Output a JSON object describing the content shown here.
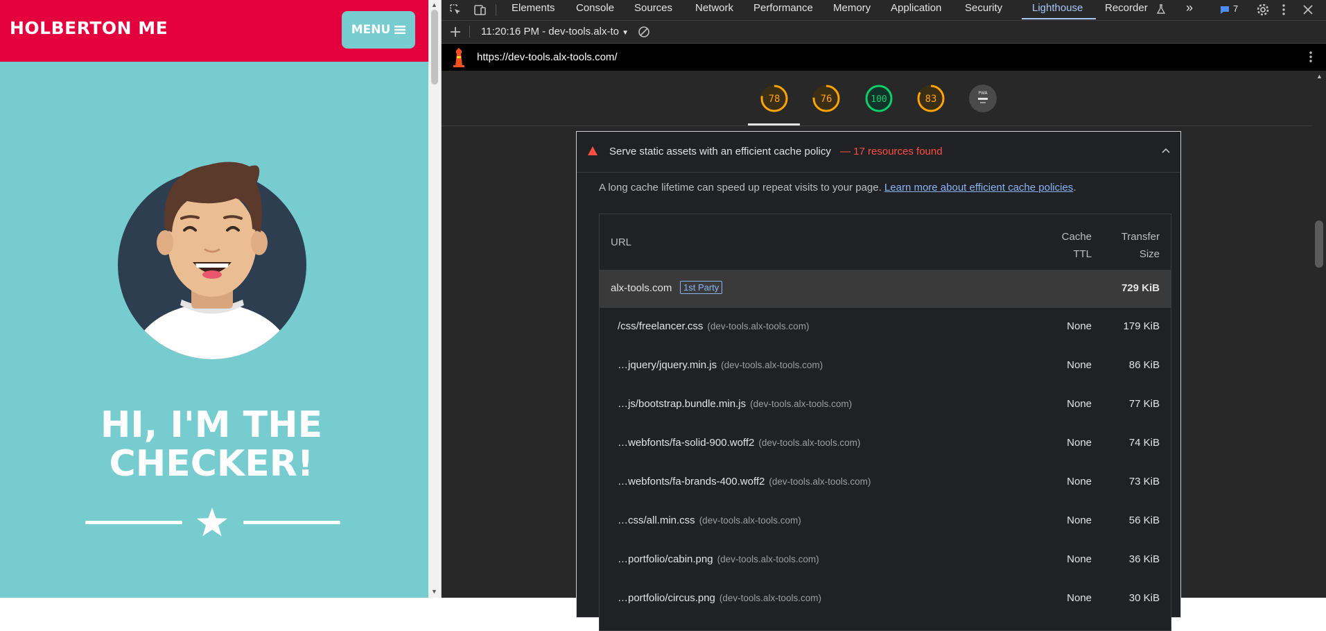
{
  "page": {
    "brand": "HOLBERTON ME",
    "menu_label": "MENU",
    "hero_line1": "HI, I'M THE",
    "hero_line2": "CHECKER!"
  },
  "devtools": {
    "tabs": [
      "Elements",
      "Console",
      "Sources",
      "Network",
      "Performance",
      "Memory",
      "Application",
      "Security",
      "Lighthouse",
      "Recorder"
    ],
    "active_tab": "Lighthouse",
    "issues_count": "7",
    "report_selector": "11:20:16 PM - dev-tools.alx-to",
    "report_url": "https://dev-tools.alx-tools.com/",
    "scores": [
      {
        "value": 78,
        "label": "78",
        "color": "#ffa400"
      },
      {
        "value": 76,
        "label": "76",
        "color": "#ffa400"
      },
      {
        "value": 100,
        "label": "100",
        "color": "#0cce6b"
      },
      {
        "value": 83,
        "label": "83",
        "color": "#ffa400"
      },
      {
        "label": "PWA",
        "color": "#9e9e9e"
      }
    ],
    "audit": {
      "title": "Serve static assets with an efficient cache policy",
      "summary": "— 17 resources found",
      "description": "A long cache lifetime can speed up repeat visits to your page.",
      "learn_more": "Learn more about efficient cache policies",
      "description_end": ".",
      "columns": {
        "url": "URL",
        "ttl_1": "Cache",
        "ttl_2": "TTL",
        "size_1": "Transfer",
        "size_2": "Size"
      },
      "party": {
        "domain": "alx-tools.com",
        "badge": "1st Party",
        "size": "729 KiB"
      },
      "rows": [
        {
          "url": "/css/freelancer.css",
          "host": "(dev-tools.alx-tools.com)",
          "ttl": "None",
          "size": "179 KiB"
        },
        {
          "url": "…jquery/jquery.min.js",
          "host": "(dev-tools.alx-tools.com)",
          "ttl": "None",
          "size": "86 KiB"
        },
        {
          "url": "…js/bootstrap.bundle.min.js",
          "host": "(dev-tools.alx-tools.com)",
          "ttl": "None",
          "size": "77 KiB"
        },
        {
          "url": "…webfonts/fa-solid-900.woff2",
          "host": "(dev-tools.alx-tools.com)",
          "ttl": "None",
          "size": "74 KiB"
        },
        {
          "url": "…webfonts/fa-brands-400.woff2",
          "host": "(dev-tools.alx-tools.com)",
          "ttl": "None",
          "size": "73 KiB"
        },
        {
          "url": "…css/all.min.css",
          "host": "(dev-tools.alx-tools.com)",
          "ttl": "None",
          "size": "56 KiB"
        },
        {
          "url": "…portfolio/cabin.png",
          "host": "(dev-tools.alx-tools.com)",
          "ttl": "None",
          "size": "36 KiB"
        },
        {
          "url": "…portfolio/circus.png",
          "host": "(dev-tools.alx-tools.com)",
          "ttl": "None",
          "size": "30 KiB"
        }
      ]
    }
  }
}
